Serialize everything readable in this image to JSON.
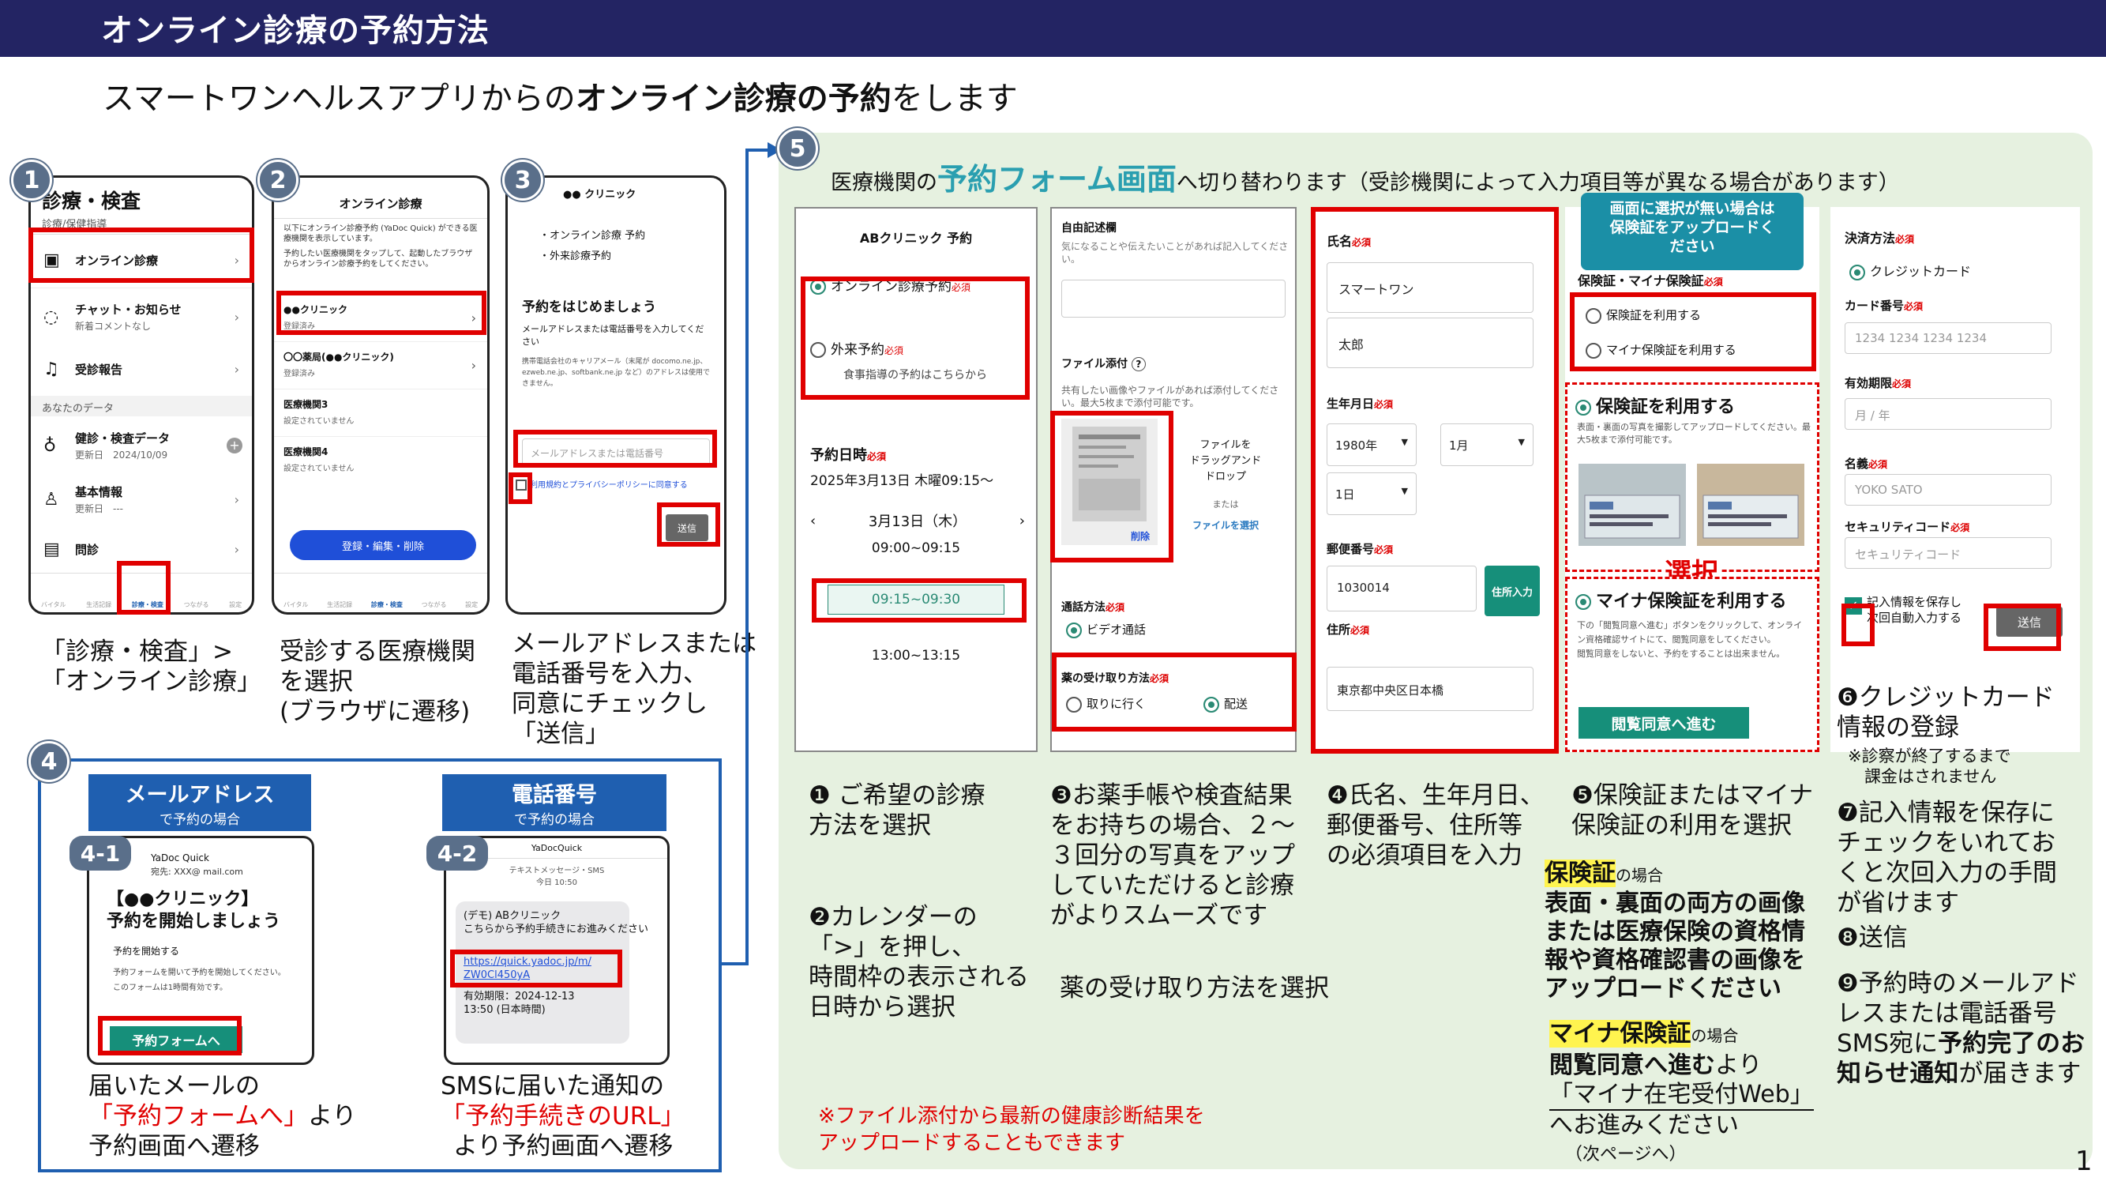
{
  "header": {
    "title": "オンライン診療の予約方法"
  },
  "subtitle": {
    "prefix": "スマートワンヘルスアプリからの",
    "bold": "オンライン診療の予約",
    "suffix": "をします"
  },
  "page_number": "1",
  "steps": {
    "s1": "1",
    "s2": "2",
    "s3": "3",
    "s4": "4",
    "s41": "4-1",
    "s42": "4-2",
    "s5": "5"
  },
  "phone1": {
    "title": "診療・検査",
    "section": "診療/保健指導",
    "items": [
      {
        "label": "オンライン診療"
      },
      {
        "label": "チャット・お知らせ",
        "sub": "新着コメントなし"
      },
      {
        "label": "受診報告"
      }
    ],
    "data_section": "あなたのデータ",
    "data_items": [
      {
        "label": "健診・検査データ",
        "sub": "更新日　2024/10/09"
      },
      {
        "label": "基本情報",
        "sub": "更新日　---"
      },
      {
        "label": "問診",
        "sub": ""
      }
    ],
    "tabs": [
      "バイタル",
      "生活記録",
      "診療・検査",
      "つながる",
      "設定"
    ]
  },
  "phone2": {
    "title": "オンライン診療",
    "intro": "以下にオンライン診療予約 (YaDoc Quick) ができる医療機関を表示しています。",
    "intro2": "予約したい医療機関をタップして、起動したブラウザからオンライン診療予約をしてください。",
    "clinics": [
      {
        "name": "●●クリニック",
        "status": "登録済み"
      },
      {
        "name": "〇〇薬局(●●クリニック)",
        "status": "登録済み"
      },
      {
        "name": "医療機関3",
        "status": "設定されていません"
      },
      {
        "name": "医療機関4",
        "status": "設定されていません"
      }
    ],
    "button": "登録・編集・削除"
  },
  "phone3": {
    "clinic": "●● クリニック",
    "bullets": [
      "オンライン診療 予約",
      "外来診療予約"
    ],
    "heading": "予約をはじめましょう",
    "desc": "メールアドレスまたは電話番号を入力してください",
    "note": "携帯電話会社のキャリアメール（末尾が docomo.ne.jp、ezweb.ne.jp、softbank.ne.jp など）のアドレスは使用できません。",
    "placeholder": "メールアドレスまたは電話番号",
    "agree": "利用規約とプライバシーポリシーに同意する",
    "send": "送信"
  },
  "captions": {
    "c1": "「診療・検査」>\n「オンライン診療」",
    "c2": "受診する医療機関\nを選択\n(ブラウザに遷移)",
    "c3": "メールアドレスまたは\n電話番号を入力、\n同意にチェックし\n「送信」"
  },
  "mail": {
    "tab_title": "メールアドレス",
    "tab_sub": "で予約の場合",
    "from": "YaDoc Quick",
    "to": "宛先: XXX@ mail.com",
    "heading": "【●●クリニック】\n予約を開始しましょう",
    "p1": "予約を開始する",
    "p2": "予約フォームを開いて予約を開始してください。",
    "p3": "このフォームは1時間有効です。",
    "button": "予約フォームへ",
    "cap_a": "届いたメールの",
    "cap_b": "「予約フォームへ」",
    "cap_c": "より",
    "cap_d": "予約画面へ遷移"
  },
  "sms": {
    "tab_title": "電話番号",
    "tab_sub": "で予約の場合",
    "app": "YaDocQuick",
    "meta": "テキストメッセージ・SMS\n今日 10:50",
    "msg1": "(デモ) ABクリニック\nこちらから予約手続きにお進みください",
    "url": "https://quick.yadoc.jp/m/\nZW0Cl450yA",
    "msg2": "有効期限：2024-12-13\n13:50 (日本時間)",
    "cap_a": "SMSに届いた通知の",
    "cap_b": "「予約手続きのURL」",
    "cap_c": "より予約画面へ遷移"
  },
  "form": {
    "intro_a": "医療機関の",
    "intro_b": "予約フォーム画面",
    "intro_c": "へ切り替わります（受診機関によって入力項目等が異なる場合があります）",
    "p1": {
      "title": "ABクリニック 予約",
      "opt1": "オンライン診療予約",
      "opt2": "外来予約",
      "opt2_sub": "食事指導の予約はこちらから",
      "req": "必須",
      "date_label": "予約日時",
      "date_value": "2025年3月13日 木曜09:15〜",
      "cal_day": "3月13日（木）",
      "slots": [
        "09:00~09:15",
        "09:15~09:30",
        "13:00~13:15"
      ]
    },
    "p2": {
      "free": "自由記述欄",
      "free_ph": "気になることや伝えたいことがあれば記入してください。",
      "file": "ファイル添付",
      "file_desc": "共有したい画像やファイルがあれば添付してください。最大5枚まで添付可能です。",
      "drop": "ファイルを\nドラッグアンド\nドロップ",
      "or": "または",
      "select": "ファイルを選択",
      "delete": "削除",
      "call": "通話方法",
      "video": "ビデオ通話",
      "pickup": "薬の受け取り方法",
      "pick_opt1": "取りに行く",
      "pick_opt2": "配送"
    },
    "p3": {
      "name": "氏名",
      "last": "スマートワン",
      "first": "太郎",
      "dob": "生年月日",
      "year": "1980年",
      "month": "1月",
      "day": "1日",
      "zip": "郵便番号",
      "zip_val": "1030014",
      "zip_btn": "住所入力",
      "addr": "住所",
      "addr_val": "東京都中央区日本橋"
    },
    "p4": {
      "callout": "画面に選択が無い場合は\n保険証をアップロードく\nださい",
      "label": "保険証・マイナ保険証",
      "opt1": "保険証を利用する",
      "opt2": "マイナ保険証を利用する",
      "h1": "保険証を利用する",
      "h1_desc": "表面・裏面の写真を撮影してアップロードしてください。最大5枚まで添付可能です。",
      "select": "選択",
      "h2": "マイナ保険証を利用する",
      "h2_desc": "下の「閲覧同意へ進む」ボタンをクリックして、オンライン資格確認サイトにて、閲覧同意をしてください。\n閲覧同意をしないと、予約をすることは出来ません。",
      "btn": "閲覧同意へ進む"
    },
    "p5": {
      "pay": "決済方法",
      "credit": "クレジットカード",
      "card": "カード番号",
      "card_ph": "1234 1234 1234 1234",
      "exp": "有効期限",
      "exp_ph": "月 / 年",
      "name": "名義",
      "name_ph": "YOKO SATO",
      "sec": "セキュリティコード",
      "sec_ph": "セキュリティコード",
      "save": "記入情報を保存し\n次回自動入力する",
      "send": "送信"
    }
  },
  "notes": {
    "n1": "❶ ご希望の診療\n方法を選択",
    "n2": "❷カレンダーの\n「>」を押し、\n時間枠の表示される\n日時から選択",
    "n3": "❸お薬手帳や検査結果\nをお持ちの場合、２～\n３回分の写真をアップ\nしていただけると診療\nがよりスムーズです",
    "n3b": "薬の受け取り方法を選択",
    "n4": "❹氏名、生年月日、\n郵便番号、住所等\nの必須項目を入力",
    "n5": "❺保険証またはマイナ\n保険証の利用を選択",
    "h_kenpo": "保険証",
    "h_kenpo_s": "の場合",
    "kenpo_body": "表面・裏面の両方の画像\nまたは医療保険の資格情\n報や資格確認書の画像を\nアップロードください",
    "h_myna": "マイナ保険証",
    "h_myna_s": "の場合",
    "myna_a": "閲覧同意へ進む",
    "myna_b": "より",
    "myna_c": "「マイナ在宅受付Web」",
    "myna_d": "へお進みください",
    "myna_e": "（次ページへ）",
    "n6": "❻クレジットカード\n情報の登録",
    "n6s": "※診察が終了するまで\n　課金はされません",
    "n7": "❼記入情報を保存に\nチェックをいれてお\nくと次回入力の手間\nが省けます",
    "n8": "❽送信",
    "n9a": "❾予約時のメールアド\nレスまたは電話番号\nSMS宛に",
    "n9b": "予約完了のお\n知らせ通知",
    "n9c": "が届きます",
    "file_note": "※ファイル添付から最新の健康診断結果を\nアップロードすることもできます"
  },
  "colors": {
    "header": "#232463",
    "red": "#e00000",
    "green": "#168f7a",
    "panel": "#e6f1e0",
    "badge": "#5a6f8a",
    "tab": "#1f5fb0"
  }
}
